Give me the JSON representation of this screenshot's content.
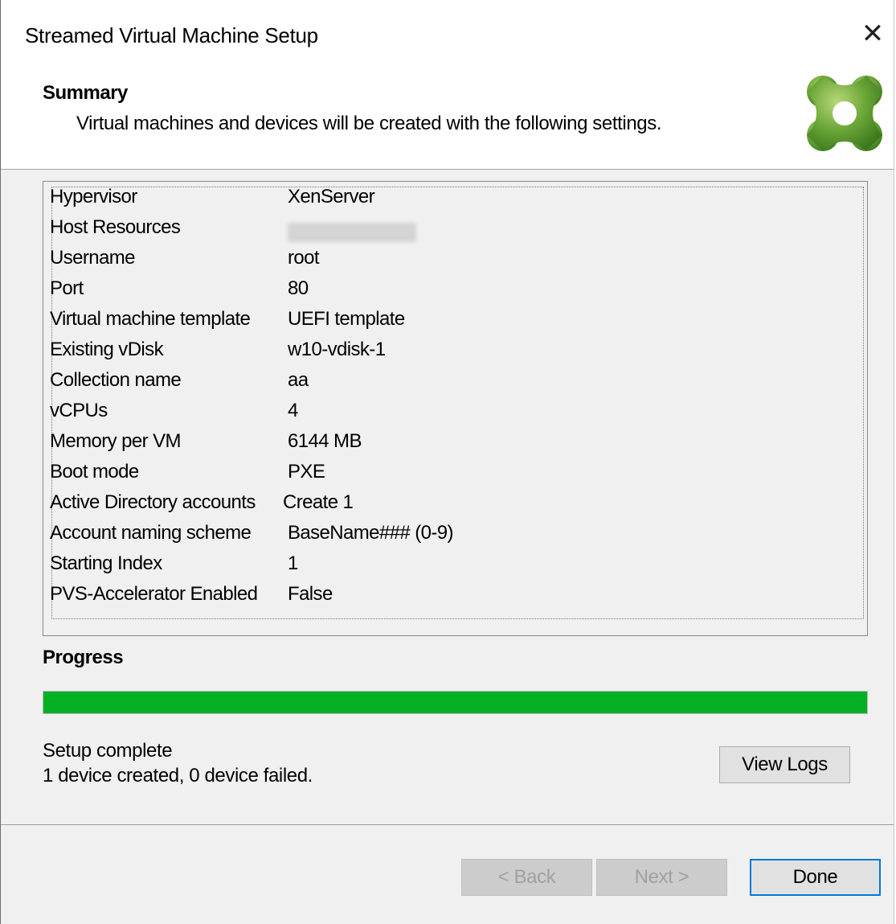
{
  "window": {
    "title": "Streamed Virtual Machine Setup",
    "close_symbol": "✕"
  },
  "header": {
    "title": "Summary",
    "subtitle": "Virtual machines and devices will be created with the following settings.",
    "logo_icon": "citrix-logo-icon"
  },
  "summary": {
    "rows": [
      {
        "key": "Hypervisor",
        "value": "XenServer"
      },
      {
        "key": "Host Resources",
        "value": ""
      },
      {
        "key": "Username",
        "value": "root"
      },
      {
        "key": "Port",
        "value": "80"
      },
      {
        "key": "Virtual machine template",
        "value": "UEFI template"
      },
      {
        "key": "Existing vDisk",
        "value": "w10-vdisk-1"
      },
      {
        "key": "Collection name",
        "value": "aa"
      },
      {
        "key": "vCPUs",
        "value": "4"
      },
      {
        "key": "Memory per VM",
        "value": "6144 MB"
      },
      {
        "key": "Boot mode",
        "value": "PXE"
      },
      {
        "key": "Active Directory accounts",
        "value": "Create 1"
      },
      {
        "key": "Account naming scheme",
        "value": "BaseName### (0-9)"
      },
      {
        "key": "Starting Index",
        "value": "1"
      },
      {
        "key": "PVS-Accelerator Enabled",
        "value": "False"
      }
    ]
  },
  "progress": {
    "title": "Progress",
    "percent": 100,
    "color": "#06b025",
    "status_line1": "Setup complete",
    "status_line2": "1 device created, 0 device failed."
  },
  "buttons": {
    "view_logs": "View Logs",
    "back": "< Back",
    "next": "Next >",
    "done": "Done"
  }
}
